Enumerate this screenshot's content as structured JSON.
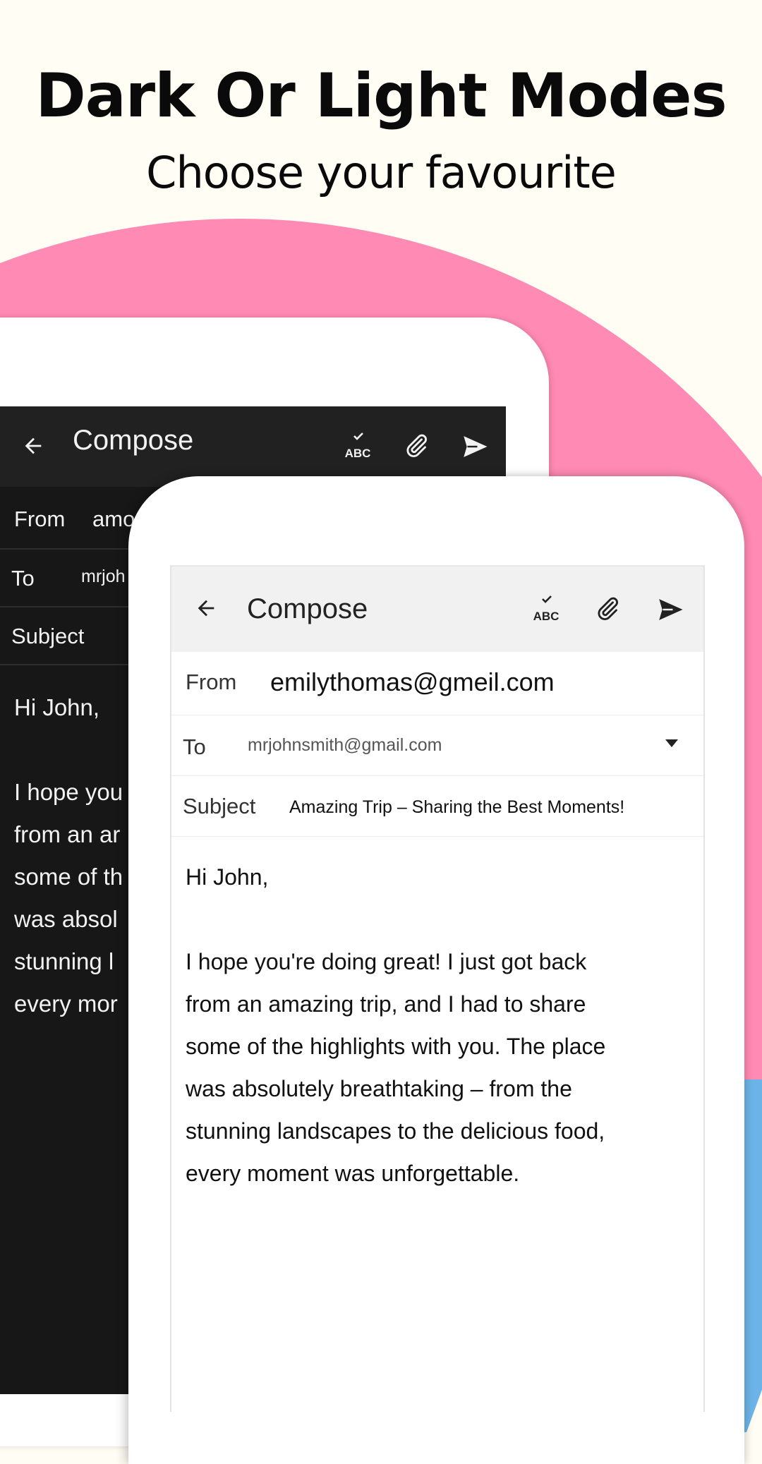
{
  "header": {
    "title": "Dark Or Light Modes",
    "subtitle": "Choose your favourite"
  },
  "colors": {
    "background": "#fffdf4",
    "pink_accent": "#ff8ab3",
    "blue_accent": "#6cb4e8",
    "dark_appbar": "#212121",
    "dark_screen": "#171717",
    "light_appbar": "#f1f1f1"
  },
  "dark_phone": {
    "appbar": {
      "back_icon": "arrow-left-icon",
      "title": "Compose",
      "spellcheck_icon": "spellcheck-icon",
      "attach_icon": "paperclip-icon",
      "send_icon": "send-icon"
    },
    "from_label": "From",
    "from_value": "amo",
    "to_label": "To",
    "to_value": "mrjoh",
    "subject_label": "Subject",
    "body_lines": [
      "Hi John,",
      "",
      "I hope you",
      "from an ar",
      "some of th",
      "was absol",
      "stunning l",
      "every mor"
    ]
  },
  "light_phone": {
    "appbar": {
      "back_icon": "arrow-left-icon",
      "title": "Compose",
      "spellcheck_icon": "spellcheck-icon",
      "attach_icon": "paperclip-icon",
      "send_icon": "send-icon"
    },
    "from_label": "From",
    "from_value": "emilythomas@gmeil.com",
    "to_label": "To",
    "to_value": "mrjohnsmith@gmail.com",
    "to_dropdown_icon": "caret-down-icon",
    "subject_label": "Subject",
    "subject_value": "Amazing Trip – Sharing the Best Moments!",
    "body_lines": [
      "Hi John,",
      "",
      "I hope you're doing great! I just got back",
      "from an amazing trip, and I had to share",
      "some of the highlights with you. The place",
      "was absolutely breathtaking – from the",
      "stunning landscapes to the delicious food,",
      "every moment was unforgettable."
    ]
  }
}
